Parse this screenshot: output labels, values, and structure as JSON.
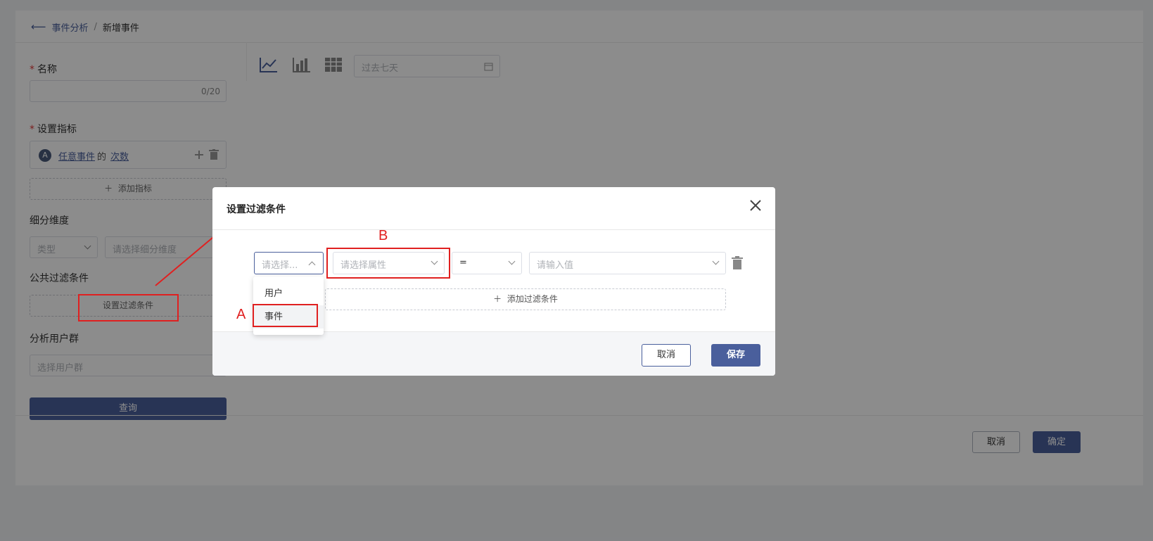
{
  "breadcrumb": {
    "parent": "事件分析",
    "separator": "/",
    "current": "新增事件"
  },
  "form": {
    "name_label": "名称",
    "name_counter": "0/20",
    "metric_label": "设置指标",
    "metric": {
      "badge": "A",
      "event": "任意事件",
      "of": "的",
      "measure": "次数"
    },
    "add_metric": "添加指标",
    "dimension_label": "细分维度",
    "dimension_type_placeholder": "类型",
    "dimension_placeholder": "请选择细分维度",
    "filter_label": "公共过滤条件",
    "filter_button": "设置过滤条件",
    "usergroup_label": "分析用户群",
    "usergroup_placeholder": "选择用户群",
    "query_button": "查询"
  },
  "toolbar": {
    "date_placeholder": "过去七天",
    "chart_types": [
      "line-chart-icon",
      "bar-chart-icon",
      "table-icon"
    ]
  },
  "footer": {
    "cancel": "取消",
    "confirm": "确定"
  },
  "modal": {
    "title": "设置过滤条件",
    "type_placeholder": "请选择...",
    "property_placeholder": "请选择属性",
    "operator": "=",
    "value_placeholder": "请输入值",
    "add_filter": "添加过滤条件",
    "dropdown_options": [
      "用户",
      "事件"
    ],
    "cancel": "取消",
    "save": "保存"
  },
  "annotations": {
    "a": "A",
    "b": "B"
  },
  "colors": {
    "accent": "#4a5f9c",
    "annotation": "#e02020"
  }
}
